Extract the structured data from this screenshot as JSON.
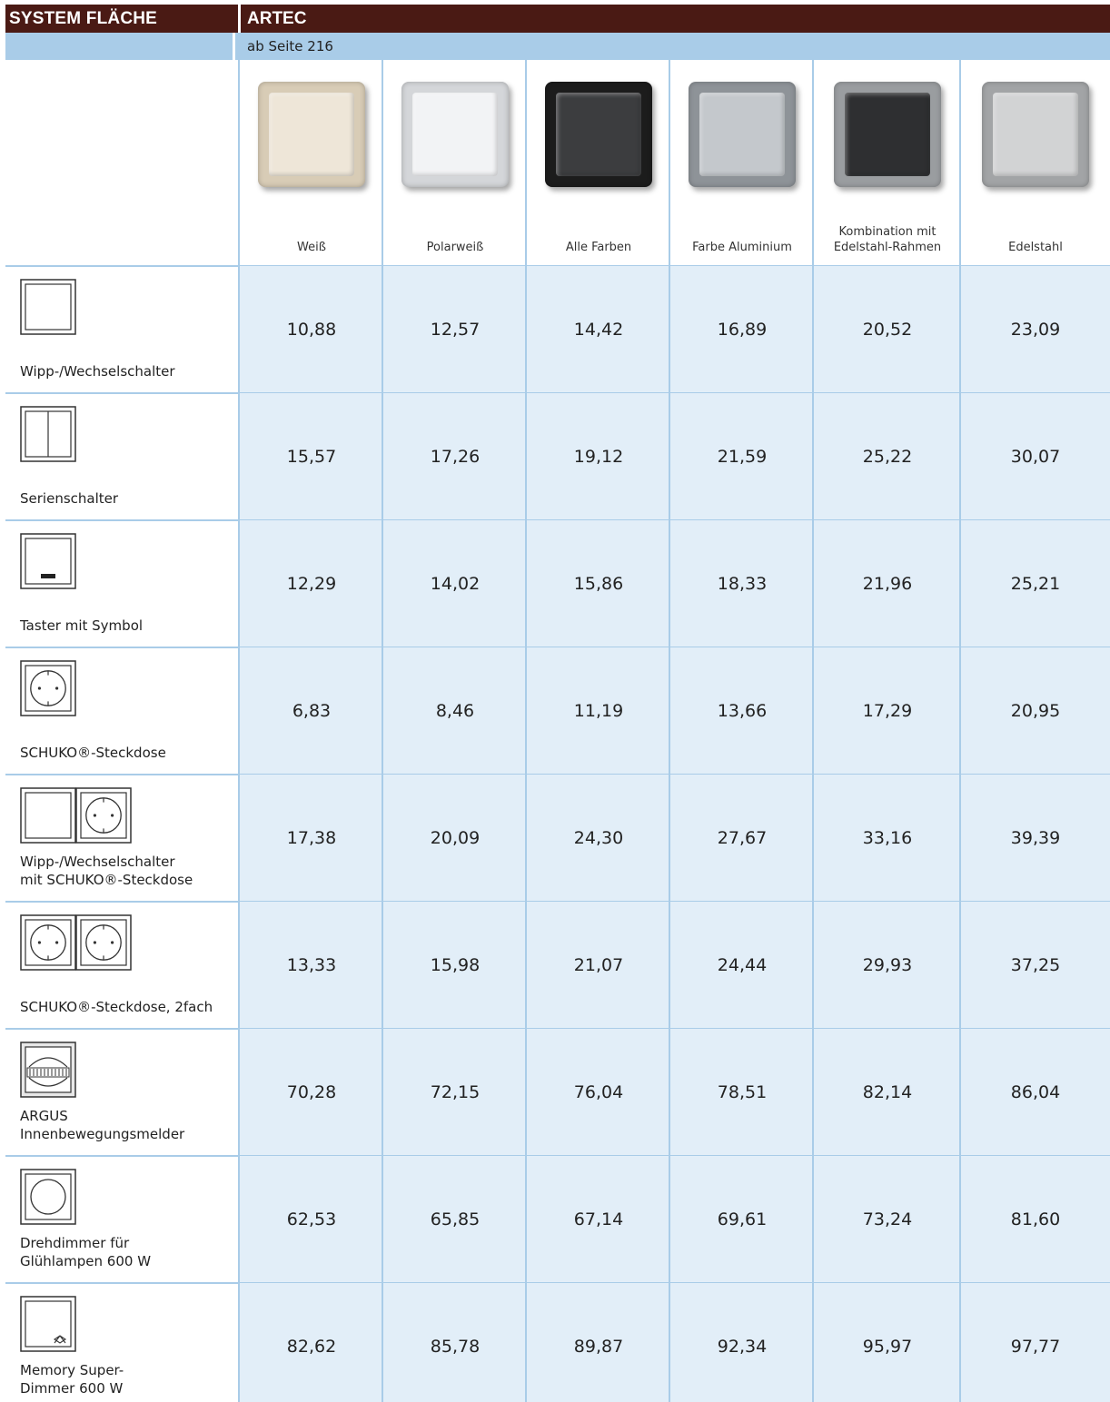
{
  "header": {
    "system_label": "SYSTEM FLÄCHE",
    "product_label": "ARTEC",
    "page_ref": "ab Seite 216"
  },
  "columns": [
    {
      "label": "Weiß",
      "swatch_outer": "#d8ccb6",
      "swatch_inner": "#eee6d8",
      "icon": "switch-swatch-icon"
    },
    {
      "label": "Polarweiß",
      "swatch_outer": "#d4d6d9",
      "swatch_inner": "#f2f3f5",
      "icon": "switch-swatch-icon"
    },
    {
      "label": "Alle Farben",
      "swatch_outer": "#1c1c1c",
      "swatch_inner": "#3c3d3f",
      "icon": "switch-swatch-icon"
    },
    {
      "label": "Farbe Aluminium",
      "swatch_outer": "#8e9398",
      "swatch_inner": "#c4c8cc",
      "icon": "switch-swatch-icon"
    },
    {
      "label_line1": "Kombination mit",
      "label_line2": "Edelstahl-Rahmen",
      "swatch_outer": "#9a9da0",
      "swatch_inner": "#2e2f31",
      "icon": "switch-swatch-icon"
    },
    {
      "label": "Edelstahl",
      "swatch_outer": "#a2a4a6",
      "swatch_inner": "#d2d3d4",
      "icon": "switch-swatch-icon"
    }
  ],
  "rows": [
    {
      "label_line1": "Wipp-/Wechselschalter",
      "label_line2": "",
      "icon": "rocker-switch-icon",
      "prices": [
        "10,88",
        "12,57",
        "14,42",
        "16,89",
        "20,52",
        "23,09"
      ]
    },
    {
      "label_line1": "Serienschalter",
      "label_line2": "",
      "icon": "series-switch-icon",
      "prices": [
        "15,57",
        "17,26",
        "19,12",
        "21,59",
        "25,22",
        "30,07"
      ]
    },
    {
      "label_line1": "Taster mit Symbol",
      "label_line2": "",
      "icon": "push-button-icon",
      "prices": [
        "12,29",
        "14,02",
        "15,86",
        "18,33",
        "21,96",
        "25,21"
      ]
    },
    {
      "label_line1": "SCHUKO®-Steckdose",
      "label_line2": "",
      "icon": "socket-icon",
      "prices": [
        "6,83",
        "8,46",
        "11,19",
        "13,66",
        "17,29",
        "20,95"
      ]
    },
    {
      "label_line1": "Wipp-/Wechselschalter",
      "label_line2": "mit SCHUKO®-Steckdose",
      "icon": "switch-socket-combo-icon",
      "prices": [
        "17,38",
        "20,09",
        "24,30",
        "27,67",
        "33,16",
        "39,39"
      ]
    },
    {
      "label_line1": "SCHUKO®-Steckdose, 2fach",
      "label_line2": "",
      "icon": "double-socket-icon",
      "prices": [
        "13,33",
        "15,98",
        "21,07",
        "24,44",
        "29,93",
        "37,25"
      ]
    },
    {
      "label_line1": "ARGUS",
      "label_line2": "Innenbewegungsmelder",
      "icon": "motion-detector-icon",
      "prices": [
        "70,28",
        "72,15",
        "76,04",
        "78,51",
        "82,14",
        "86,04"
      ]
    },
    {
      "label_line1": "Drehdimmer für",
      "label_line2": "Glühlampen 600 W",
      "icon": "rotary-dimmer-icon",
      "prices": [
        "62,53",
        "65,85",
        "67,14",
        "69,61",
        "73,24",
        "81,60"
      ]
    },
    {
      "label_line1": "Memory Super-",
      "label_line2": "Dimmer 600 W",
      "icon": "super-dimmer-icon",
      "prices": [
        "82,62",
        "85,78",
        "89,87",
        "92,34",
        "95,97",
        "97,77"
      ]
    }
  ]
}
